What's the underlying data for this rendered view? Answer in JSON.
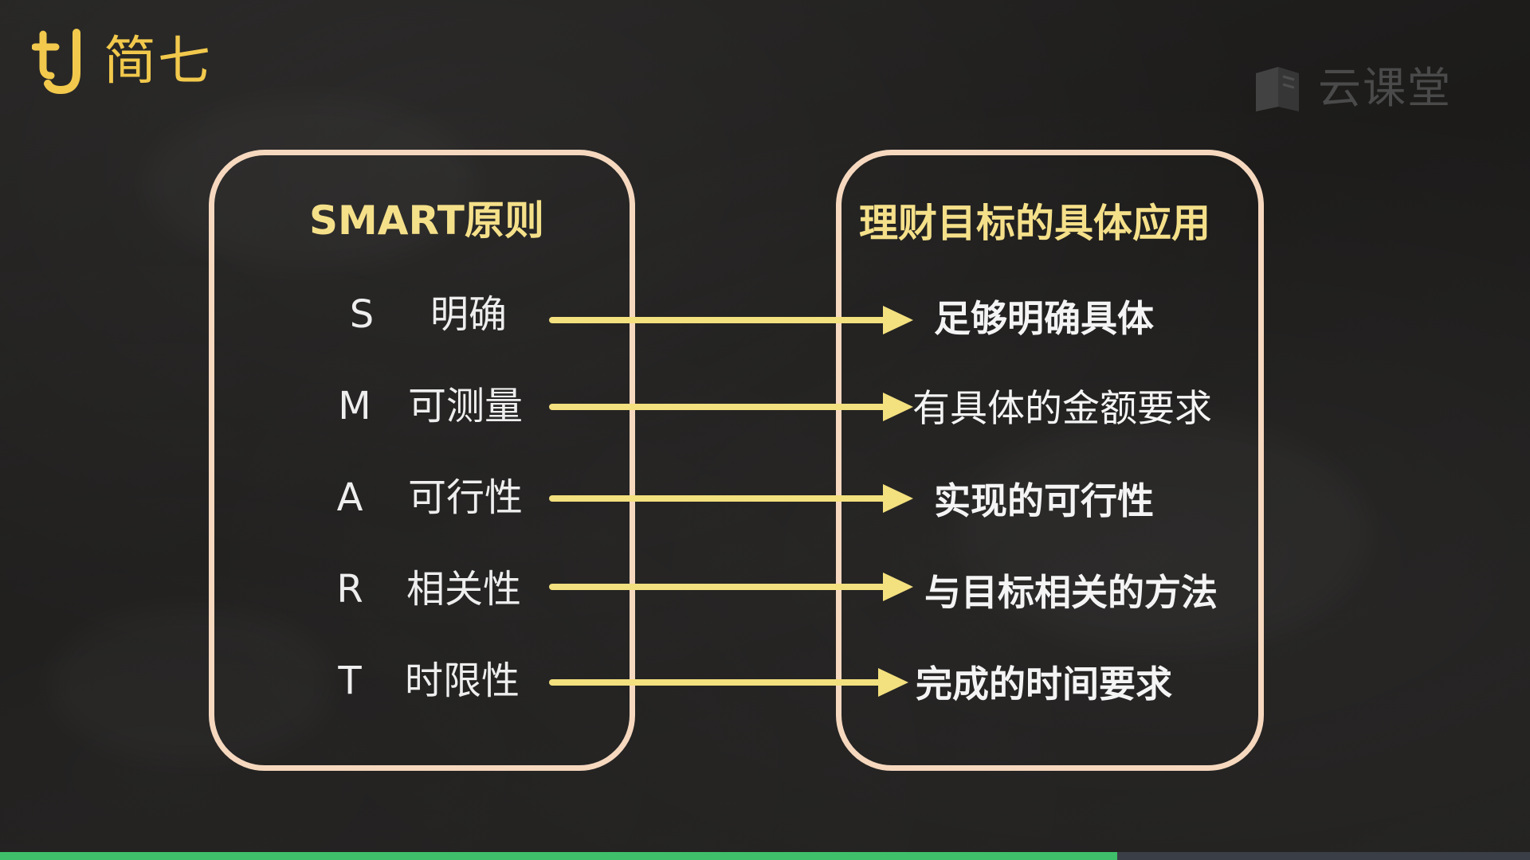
{
  "brand": {
    "name": "简七",
    "mark_text": "tJ",
    "color": "#f2c94c"
  },
  "watermark": {
    "text": "云课堂",
    "icon": "book-icon"
  },
  "diagram": {
    "left_title": "SMART原则",
    "right_title": "理财目标的具体应用",
    "rows": [
      {
        "letter": "S",
        "meaning": "明确",
        "application": "足够明确具体"
      },
      {
        "letter": "M",
        "meaning": "可测量",
        "application": "有具体的金额要求"
      },
      {
        "letter": "A",
        "meaning": "可行性",
        "application": "实现的可行性"
      },
      {
        "letter": "R",
        "meaning": "相关性",
        "application": "与目标相关的方法"
      },
      {
        "letter": "T",
        "meaning": "时限性",
        "application": "完成的时间要求"
      }
    ],
    "colors": {
      "title": "#f5e08a",
      "arrow": "#f3e07e",
      "border": "#f6d8bf"
    }
  },
  "video_progress": {
    "played_fraction": 0.73,
    "color": "#3fbf6a"
  }
}
